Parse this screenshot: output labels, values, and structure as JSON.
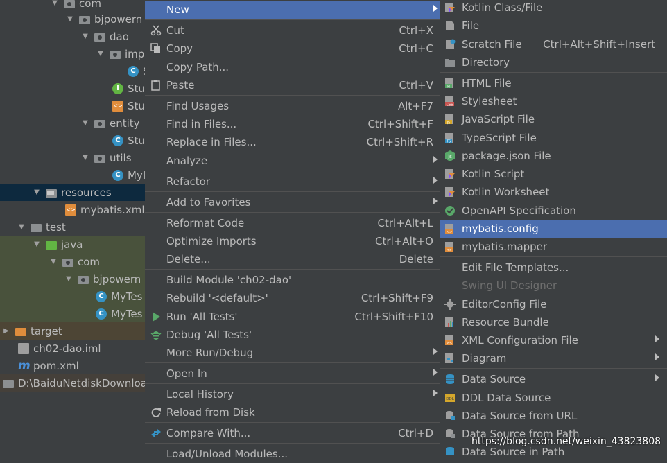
{
  "tree": {
    "items": [
      {
        "label": "com"
      },
      {
        "label": "bjpowern"
      },
      {
        "label": "dao"
      },
      {
        "label": "imp"
      },
      {
        "label": "S"
      },
      {
        "label": "Stu"
      },
      {
        "label": "Stu"
      },
      {
        "label": "entity"
      },
      {
        "label": "Stu"
      },
      {
        "label": "utils"
      },
      {
        "label": "MyI"
      },
      {
        "label": "resources"
      },
      {
        "label": "mybatis.xml"
      },
      {
        "label": "test"
      },
      {
        "label": "java"
      },
      {
        "label": "com"
      },
      {
        "label": "bjpowern"
      },
      {
        "label": "MyTes"
      },
      {
        "label": "MyTes"
      },
      {
        "label": "target"
      },
      {
        "label": "ch02-dao.iml"
      },
      {
        "label": "pom.xml"
      },
      {
        "label": "D:\\BaiduNetdiskDownload"
      }
    ]
  },
  "menu": {
    "items": [
      {
        "label": "New",
        "shortcut": ""
      },
      {
        "label": "Cut",
        "shortcut": "Ctrl+X"
      },
      {
        "label": "Copy",
        "shortcut": "Ctrl+C"
      },
      {
        "label": "Copy Path...",
        "shortcut": ""
      },
      {
        "label": "Paste",
        "shortcut": "Ctrl+V"
      },
      {
        "label": "Find Usages",
        "shortcut": "Alt+F7"
      },
      {
        "label": "Find in Files...",
        "shortcut": "Ctrl+Shift+F"
      },
      {
        "label": "Replace in Files...",
        "shortcut": "Ctrl+Shift+R"
      },
      {
        "label": "Analyze",
        "shortcut": ""
      },
      {
        "label": "Refactor",
        "shortcut": ""
      },
      {
        "label": "Add to Favorites",
        "shortcut": ""
      },
      {
        "label": "Reformat Code",
        "shortcut": "Ctrl+Alt+L"
      },
      {
        "label": "Optimize Imports",
        "shortcut": "Ctrl+Alt+O"
      },
      {
        "label": "Delete...",
        "shortcut": "Delete"
      },
      {
        "label": "Build Module 'ch02-dao'",
        "shortcut": ""
      },
      {
        "label": "Rebuild '<default>'",
        "shortcut": "Ctrl+Shift+F9"
      },
      {
        "label": "Run 'All Tests'",
        "shortcut": "Ctrl+Shift+F10"
      },
      {
        "label": "Debug 'All Tests'",
        "shortcut": ""
      },
      {
        "label": "More Run/Debug",
        "shortcut": ""
      },
      {
        "label": "Open In",
        "shortcut": ""
      },
      {
        "label": "Local History",
        "shortcut": ""
      },
      {
        "label": "Reload from Disk",
        "shortcut": ""
      },
      {
        "label": "Compare With...",
        "shortcut": "Ctrl+D"
      },
      {
        "label": "Load/Unload Modules...",
        "shortcut": ""
      }
    ]
  },
  "submenu": {
    "items": [
      {
        "label": "Kotlin Class/File",
        "shortcut": ""
      },
      {
        "label": "File",
        "shortcut": ""
      },
      {
        "label": "Scratch File",
        "shortcut": "Ctrl+Alt+Shift+Insert"
      },
      {
        "label": "Directory",
        "shortcut": ""
      },
      {
        "label": "HTML File",
        "shortcut": ""
      },
      {
        "label": "Stylesheet",
        "shortcut": ""
      },
      {
        "label": "JavaScript File",
        "shortcut": ""
      },
      {
        "label": "TypeScript File",
        "shortcut": ""
      },
      {
        "label": "package.json File",
        "shortcut": ""
      },
      {
        "label": "Kotlin Script",
        "shortcut": ""
      },
      {
        "label": "Kotlin Worksheet",
        "shortcut": ""
      },
      {
        "label": "OpenAPI Specification",
        "shortcut": ""
      },
      {
        "label": "mybatis.config",
        "shortcut": ""
      },
      {
        "label": "mybatis.mapper",
        "shortcut": ""
      },
      {
        "label": "Edit File Templates...",
        "shortcut": ""
      },
      {
        "label": "Swing UI Designer",
        "shortcut": ""
      },
      {
        "label": "EditorConfig File",
        "shortcut": ""
      },
      {
        "label": "Resource Bundle",
        "shortcut": ""
      },
      {
        "label": "XML Configuration File",
        "shortcut": ""
      },
      {
        "label": "Diagram",
        "shortcut": ""
      },
      {
        "label": "Data Source",
        "shortcut": ""
      },
      {
        "label": "DDL Data Source",
        "shortcut": ""
      },
      {
        "label": "Data Source from URL",
        "shortcut": ""
      },
      {
        "label": "Data Source from Path",
        "shortcut": ""
      },
      {
        "label": "Data Source in Path",
        "shortcut": ""
      }
    ]
  },
  "watermark": "https://blog.csdn.net/weixin_43823808",
  "colors": {
    "background": "#3c3f41",
    "highlight": "#4b6eaf",
    "text": "#bbbbbb",
    "disabled": "#6e6e6e"
  }
}
